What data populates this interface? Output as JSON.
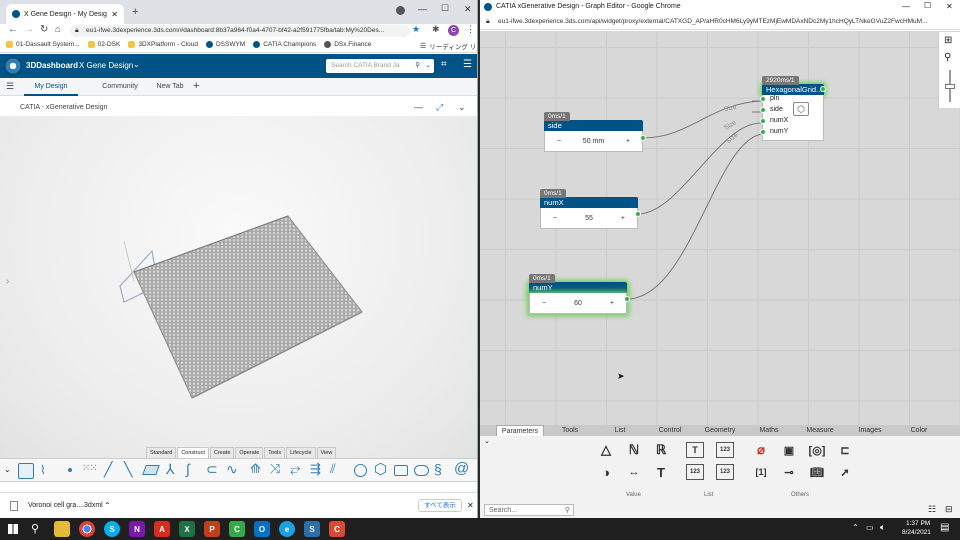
{
  "left_window": {
    "tab_title": "X Gene Design - My Design",
    "url": "eu1-ifwe.3dexperience.3ds.com/#dashboard:8b37a964-f0a4-4707-bf42-a2f591775fba/tab:My%20Des...",
    "profile_initial": "C",
    "bookmarks": [
      "01-Dassault System...",
      "02-DSK",
      "3DXPlatform - Cloud",
      "DSSWYM",
      "CATIA Champions",
      "DSx.Finance"
    ],
    "bookmarks_right": "リーディング リスト",
    "dashboard": {
      "brand": "3DDashboard",
      "name": "X Gene Design",
      "search_placeholder": "Search CATIA Brand Ja",
      "tabs": [
        "My Design",
        "Community",
        "New Tab"
      ],
      "active_tab": "My Design"
    },
    "widget_title": "CATIA - xGenerative Design",
    "command_tabs": [
      "Standard",
      "Construct",
      "Create",
      "Operate",
      "Tools",
      "Lifecycle",
      "View"
    ],
    "active_command_tab": "Construct",
    "download": {
      "filename": "Voronoi cell gra....3dxml",
      "show_all": "すべて表示"
    }
  },
  "right_window": {
    "title": "CATIA xGenerative Design - Graph Editor - Google Chrome",
    "url": "eu1-ifwe.3dexperience.3ds.com/api/widget/proxy/external/CATXGD_AP/aHR0cHM6Ly9yMTEzMjEwMDAxNDc2My1hcHQyLTNkeGVuZ2FwcHMuM...",
    "nodes": {
      "side": {
        "time": "0ms/1",
        "title": "side",
        "value": "50 mm"
      },
      "numX": {
        "time": "0ms/1",
        "title": "numX",
        "value": "55"
      },
      "numY": {
        "time": "0ms/1",
        "title": "numY",
        "value": "60"
      },
      "hexagonal": {
        "time": "2920ms/1",
        "title": "HexagonalGrid...",
        "inputs": [
          "pln",
          "side",
          "numX",
          "numY"
        ]
      }
    },
    "wire_labels": [
      "Size",
      "Size",
      "Size"
    ],
    "palette_tabs": [
      "Parameters",
      "Tools",
      "List",
      "Control",
      "Geometry",
      "Maths",
      "Measure",
      "Images",
      "Color"
    ],
    "active_palette_tab": "Parameters",
    "palette_groups": [
      "Value",
      "List",
      "Others"
    ],
    "palette_minus": "−",
    "search_placeholder": "Search..."
  },
  "taskbar": {
    "time": "1:37 PM",
    "date": "8/24/2021"
  },
  "colors": {
    "dashboard_blue": "#005386",
    "selection_green": "#6fd15a",
    "port_green": "#35b148"
  }
}
